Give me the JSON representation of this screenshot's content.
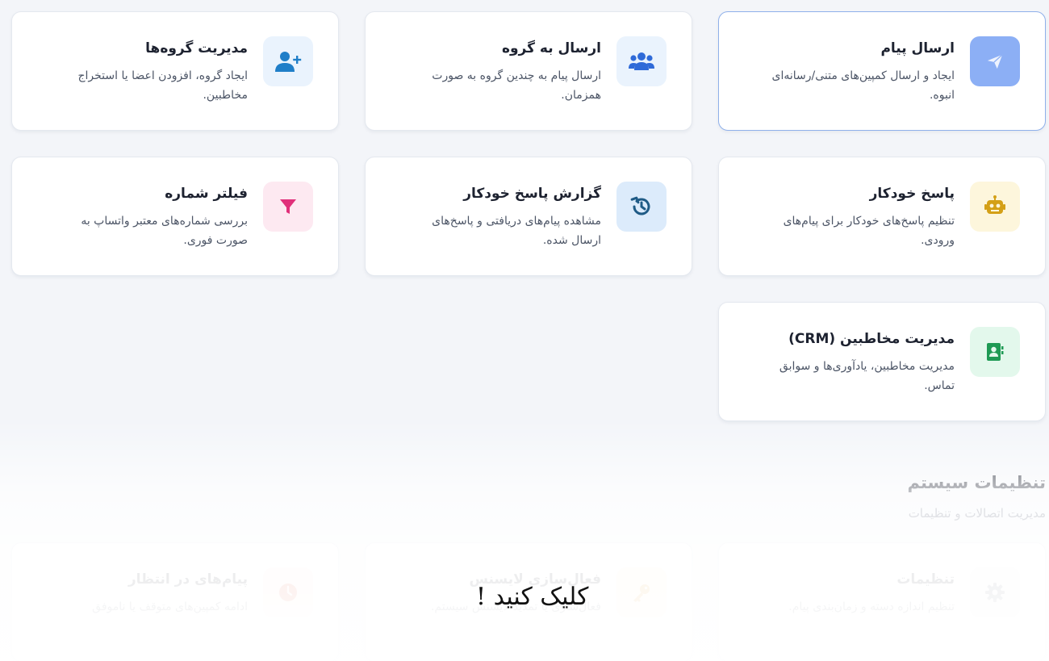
{
  "cards": {
    "send_message": {
      "title": "ارسال پیام",
      "desc": "ایجاد و ارسال کمپین‌های متنی/رسانه‌ای انبوه.",
      "icon": "paper-plane-icon",
      "icon_color": "#ffffff"
    },
    "send_to_group": {
      "title": "ارسال به گروه",
      "desc": "ارسال پیام به چندین گروه به صورت همزمان.",
      "icon": "users-icon",
      "icon_color": "#2f6ad8"
    },
    "manage_groups": {
      "title": "مدیریت گروه‌ها",
      "desc": "ایجاد گروه، افزودن اعضا یا استخراج مخاطبین.",
      "icon": "user-plus-icon",
      "icon_color": "#1f7ec8"
    },
    "auto_reply": {
      "title": "پاسخ خودکار",
      "desc": "تنظیم پاسخ‌های خودکار برای پیام‌های ورودی.",
      "icon": "robot-icon",
      "icon_color": "#d4a017"
    },
    "auto_reply_report": {
      "title": "گزارش پاسخ خودکار",
      "desc": "مشاهده پیام‌های دریافتی و پاسخ‌های ارسال شده.",
      "icon": "history-icon",
      "icon_color": "#1f5b86"
    },
    "number_filter": {
      "title": "فیلتر شماره",
      "desc": "بررسی شماره‌های معتبر واتساپ به صورت فوری.",
      "icon": "filter-icon",
      "icon_color": "#e0307a"
    },
    "crm": {
      "title": "مدیریت مخاطبین (CRM)",
      "desc": "مدیریت مخاطبین، یادآوری‌ها و سوابق تماس.",
      "icon": "address-book-icon",
      "icon_color": "#1e9a54"
    }
  },
  "system_section": {
    "title": "تنظیمات سیستم",
    "subtitle": "مدیریت اتصالات و تنظیمات"
  },
  "system_cards": {
    "settings": {
      "title": "تنظیمات",
      "desc": "تنظیم اندازه دسته و زمان‌بندی پیام.",
      "icon": "gear-icon",
      "icon_color": "#6b7280"
    },
    "license": {
      "title": "فعال‌سازی لایسنس",
      "desc": "فعال‌سازی یا تمدید لایسنس سیستم.",
      "icon": "key-icon",
      "icon_color": "#e09a2a"
    },
    "pending": {
      "title": "پیام‌های در انتظار",
      "desc": "ادامه کمپین‌های متوقف یا ناموفق",
      "icon": "clock-icon",
      "icon_color": "#e0553a"
    }
  },
  "overlay": {
    "click_text": "کلیک کنید !"
  }
}
